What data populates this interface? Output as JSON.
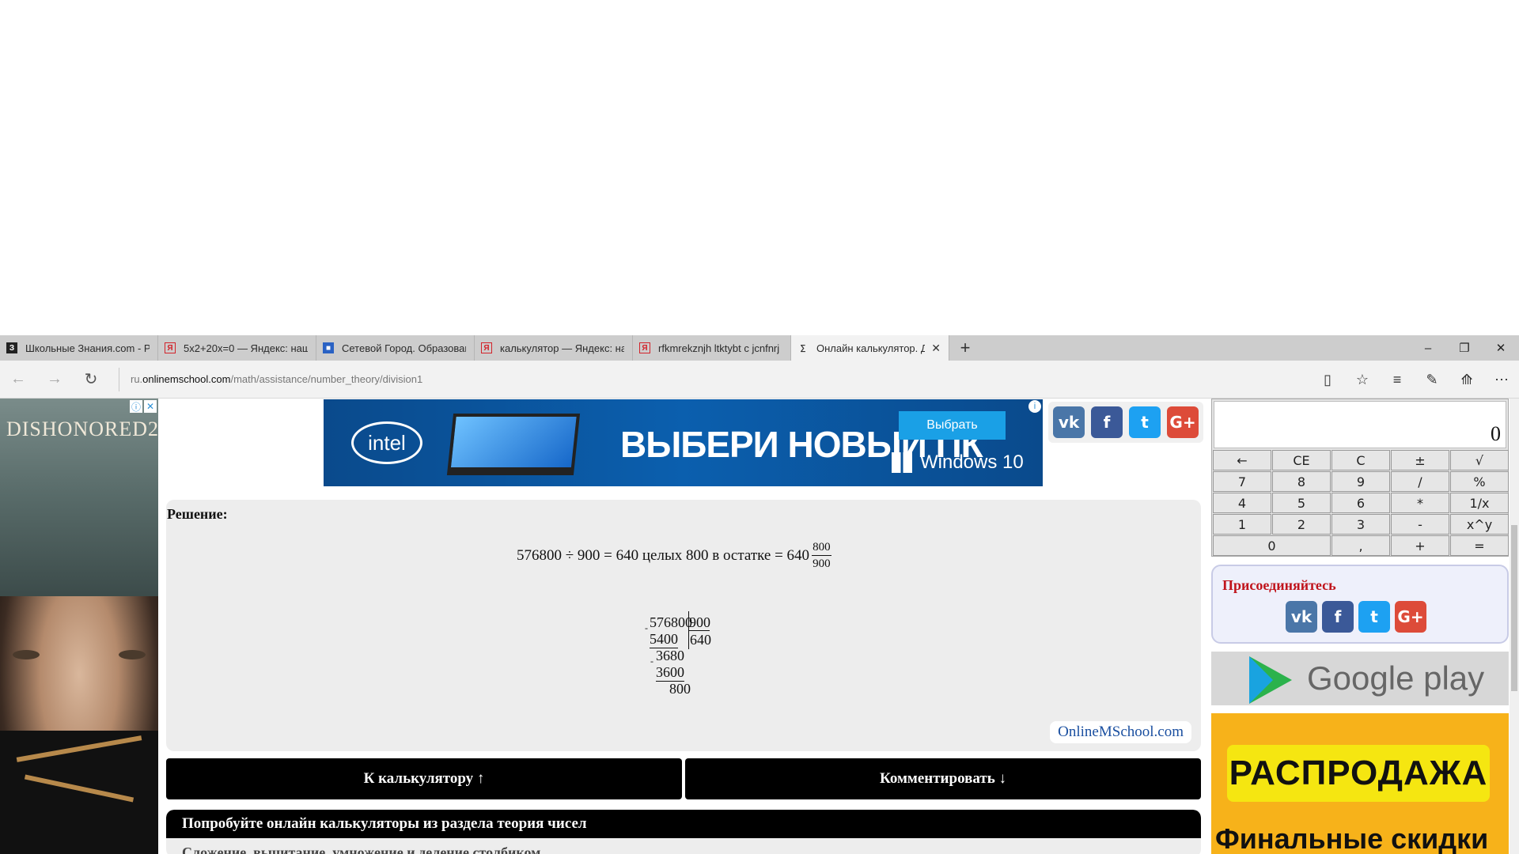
{
  "browser": {
    "tabs": [
      {
        "favicon": "З",
        "title": "Школьные Знания.com - Р",
        "active": false
      },
      {
        "favicon": "Я",
        "title": "5x2+20x=0 — Яндекс: наш",
        "active": false
      },
      {
        "favicon": "■",
        "title": "Сетевой Город. Образован",
        "active": false
      },
      {
        "favicon": "Я",
        "title": "калькулятор — Яндекс: на",
        "active": false
      },
      {
        "favicon": "Я",
        "title": "rfkmrekznjh ltktybt c jcnfnrj",
        "active": false
      },
      {
        "favicon": "∑",
        "title": "Онлайн калькулятор. Д",
        "active": true
      }
    ],
    "new_tab": "+",
    "win_controls": {
      "minimize": "–",
      "restore": "❐",
      "close": "✕"
    },
    "nav": {
      "back": "←",
      "forward": "→",
      "refresh": "↻"
    },
    "address": {
      "prefix": "ru.",
      "domain": "onlinemschool.com",
      "path": "/math/assistance/number_theory/division1"
    },
    "nav_right": {
      "reading": "▯",
      "favorite": "☆",
      "hub": "≡",
      "note": "✎",
      "share": "⟰",
      "more": "⋯"
    }
  },
  "left_ad": {
    "brand": "DISHONORED2",
    "info_icon": "ⓘ",
    "close_icon": "✕"
  },
  "banner": {
    "logo": "intel",
    "headline": "ВЫБЕРИ НОВЫЙ ПК",
    "button": "Выбрать",
    "os": "Windows 10",
    "info_icon": "i"
  },
  "social_icons": [
    "vk-icon",
    "facebook-icon",
    "twitter-icon",
    "googleplus-icon"
  ],
  "social_labels": {
    "vk": "vk",
    "fb": "f",
    "tw": "t",
    "gp": "G+"
  },
  "solution": {
    "title": "Решение:",
    "equation": "576800 ÷ 900 = 640 целых 800 в остатке = 640",
    "fraction": {
      "numerator": "800",
      "denominator": "900"
    },
    "long_division": {
      "dividend": "576800",
      "divisor": "900",
      "quotient": "640",
      "steps": [
        "5400",
        "3680",
        "3600",
        "800"
      ],
      "minus": "-"
    },
    "credit": "OnlineMSchool.com"
  },
  "buttons": {
    "to_calculator": "К калькулятору ↑",
    "comment": "Комментировать ↓"
  },
  "try_panel": {
    "header": "Попробуйте онлайн калькуляторы из раздела теория чисел",
    "item": "Сложение, вычитание, умножение и деление столбиком"
  },
  "calculator": {
    "display": "0",
    "keys": [
      {
        "label": "←",
        "wide": false
      },
      {
        "label": "CE",
        "wide": false
      },
      {
        "label": "C",
        "wide": false
      },
      {
        "label": "±",
        "wide": false
      },
      {
        "label": "√",
        "wide": false
      },
      {
        "label": "7",
        "wide": false
      },
      {
        "label": "8",
        "wide": false
      },
      {
        "label": "9",
        "wide": false
      },
      {
        "label": "/",
        "wide": false
      },
      {
        "label": "%",
        "wide": false
      },
      {
        "label": "4",
        "wide": false
      },
      {
        "label": "5",
        "wide": false
      },
      {
        "label": "6",
        "wide": false
      },
      {
        "label": "*",
        "wide": false
      },
      {
        "label": "1/x",
        "wide": false
      },
      {
        "label": "1",
        "wide": false
      },
      {
        "label": "2",
        "wide": false
      },
      {
        "label": "3",
        "wide": false
      },
      {
        "label": "-",
        "wide": false
      },
      {
        "label": "x^y",
        "wide": false
      },
      {
        "label": "0",
        "wide": true
      },
      {
        "label": ",",
        "wide": false
      },
      {
        "label": "+",
        "wide": false
      },
      {
        "label": "=",
        "wide": false
      }
    ]
  },
  "join": {
    "title": "Присоединяйтесь"
  },
  "google_play": {
    "label": "Google play"
  },
  "sale_ad": {
    "sale": "РАСПРОДАЖА",
    "final": "Финальные скидки"
  }
}
